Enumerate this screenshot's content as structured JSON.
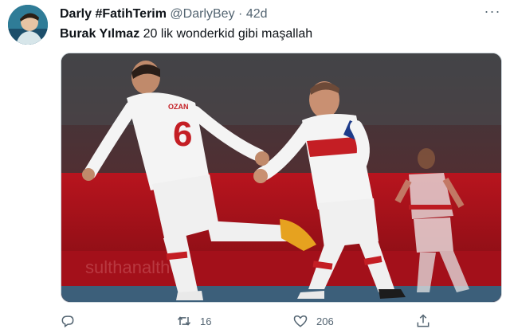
{
  "tweet": {
    "display_name": "Darly #FatihTerim",
    "handle": "@DarlyBey",
    "separator": "·",
    "time": "42d",
    "more_label": "···",
    "text_mention": "Burak Yılmaz",
    "text_body": " 20 lik wonderkid gibi maşallah"
  },
  "image": {
    "player_left_name": "OZAN",
    "player_left_number": "6",
    "board_text": "sulthanalth"
  },
  "actions": {
    "reply_count": "",
    "retweet_count": "16",
    "like_count": "206"
  },
  "icons": [
    "reply-icon",
    "retweet-icon",
    "like-icon",
    "share-icon",
    "more-icon"
  ],
  "colors": {
    "text": "#0f1419",
    "secondary": "#536471",
    "pitch_red": "#b9151f",
    "kit_white": "#f3f3f3"
  }
}
